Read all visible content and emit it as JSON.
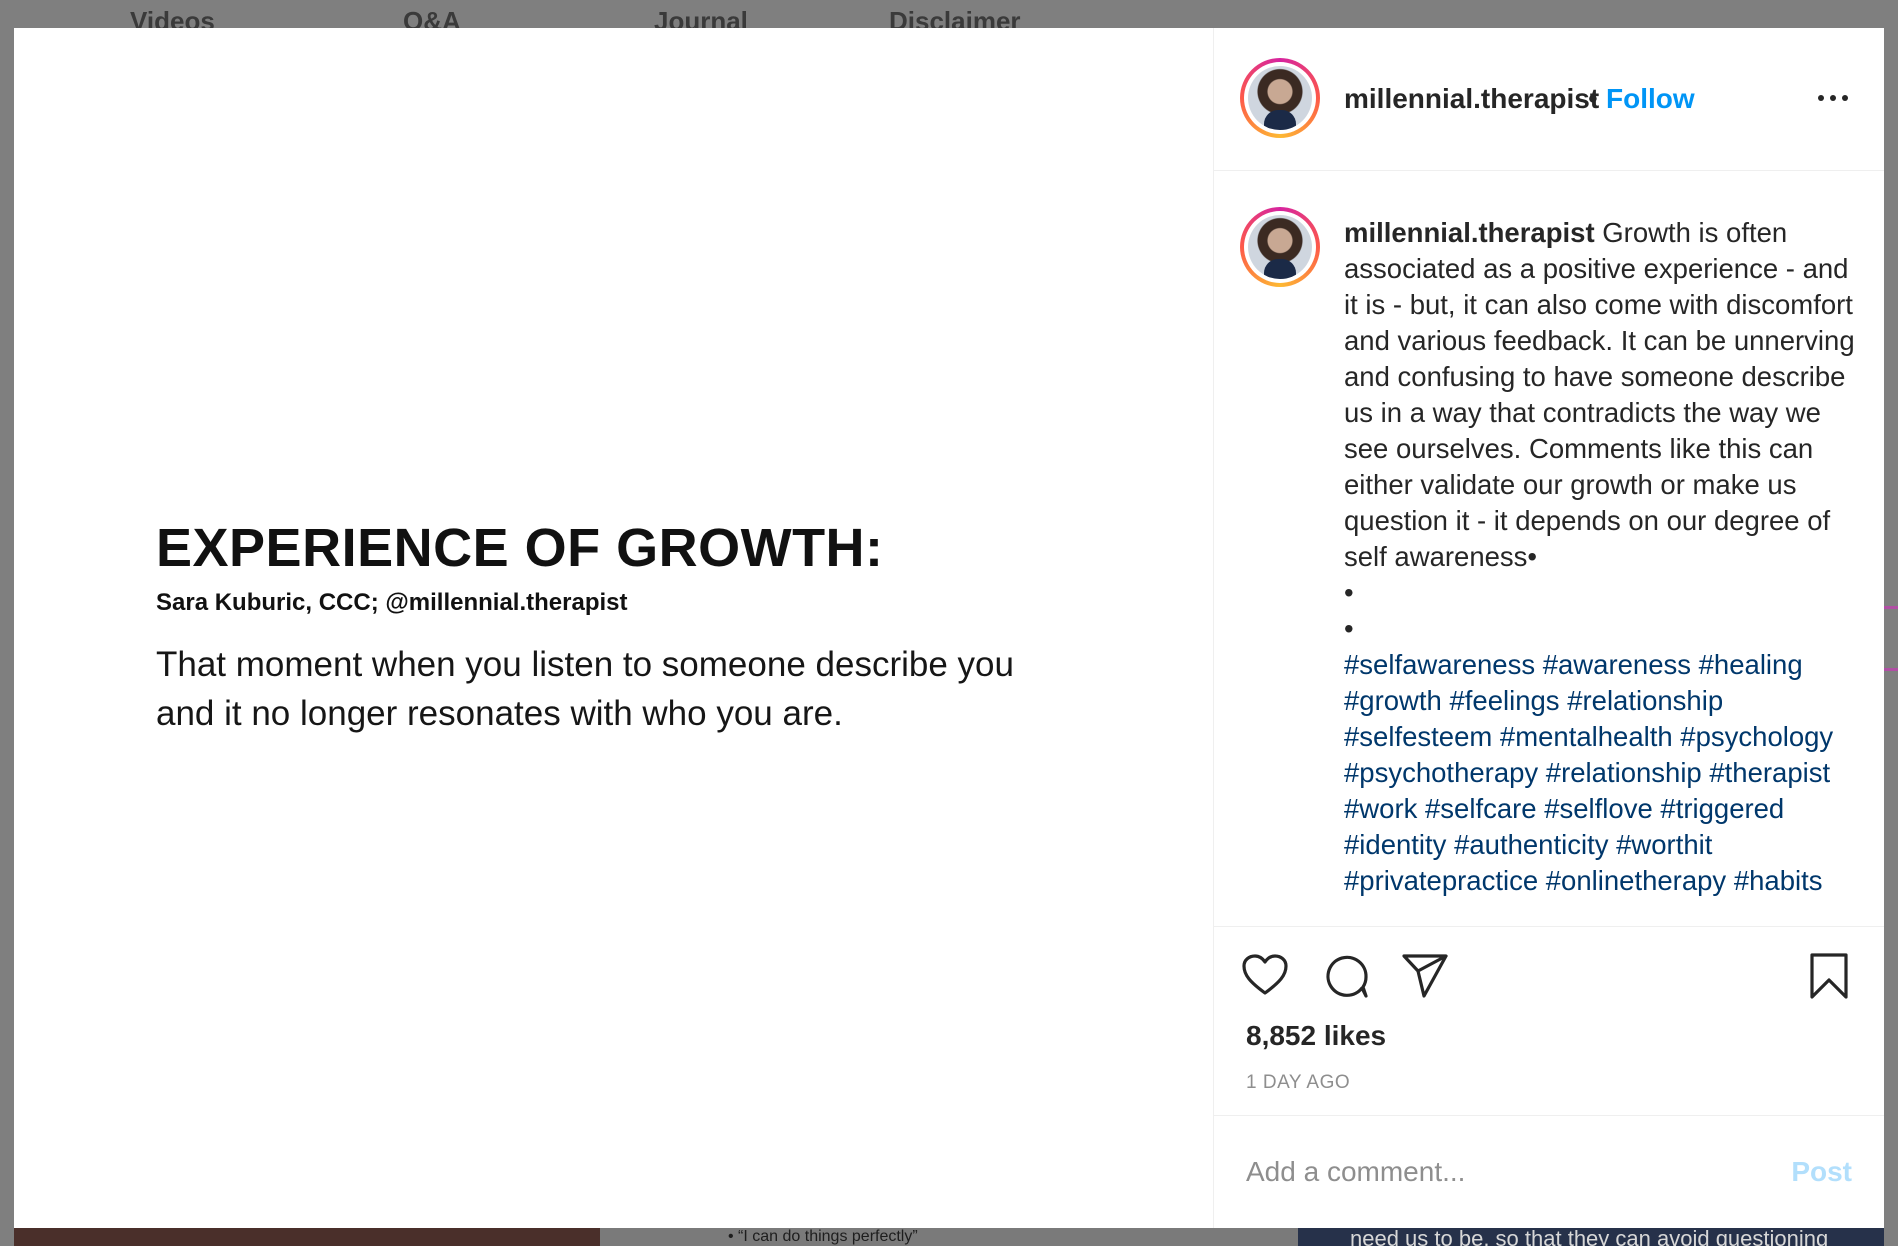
{
  "background_nav": [
    "Videos",
    "Q&A",
    "Journal",
    "Disclaimer"
  ],
  "background_bottom": {
    "middle_text": "•  “I can do things perfectly”",
    "right_text": "need us to be, so that they can avoid questioning"
  },
  "post": {
    "username": "millennial.therapist",
    "separator": "•",
    "follow_label": "Follow",
    "more_icon": "more-horizontal-icon",
    "slide": {
      "title": "EXPERIENCE OF GROWTH:",
      "byline": "Sara Kuburic, CCC; @millennial.therapist",
      "body": "That moment when you listen to someone describe you and it no longer resonates with who you are."
    },
    "caption": {
      "username": "millennial.therapist",
      "text": "Growth is often associated as a positive experience - and it is - but, it can also come with discomfort and various feedback. It can be unnerving and confusing to have someone describe us in a way that contradicts the way we see ourselves. Comments like this can either validate our growth or make us question it - it depends on our degree of self awareness•",
      "bullet_1": "•",
      "bullet_2": "•",
      "hashtags": "#selfawareness #awareness #healing #growth #feelings #relationship #selfesteem #mentalhealth #psychology #psychotherapy #relationship #therapist #work #selfcare #selflove #triggered #identity #authenticity #worthit #privatepractice #onlinetherapy #habits"
    },
    "actions": {
      "like_icon": "heart-icon",
      "comment_icon": "comment-icon",
      "share_icon": "paper-plane-icon",
      "save_icon": "bookmark-icon"
    },
    "likes": "8,852 likes",
    "time_ago": "1 DAY AGO",
    "comment_placeholder": "Add a comment...",
    "post_label": "Post"
  },
  "colors": {
    "link_blue": "#0095f6",
    "hashtag": "#00376b",
    "post_disabled": "#b2dffc"
  }
}
